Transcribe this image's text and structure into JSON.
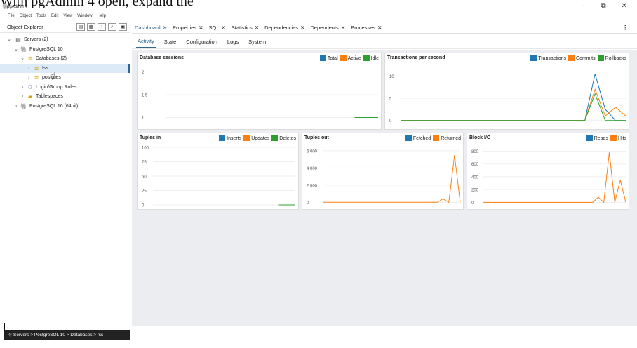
{
  "window": {
    "title": "pgAdmin 4",
    "overlay_text": "With pgAdmin 4 open, expand the",
    "controls": {
      "minimize": "–",
      "restore": "⧉",
      "close": "✕"
    }
  },
  "menu": [
    "File",
    "Object",
    "Tools",
    "Edit",
    "View",
    "Window",
    "Help"
  ],
  "explorer": {
    "title": "Object Explorer",
    "tree": [
      {
        "label": "Servers (2)"
      },
      {
        "label": "PostgreSQL 10"
      },
      {
        "label": "Databases (2)"
      },
      {
        "label": "fss"
      },
      {
        "label": "postgres"
      },
      {
        "label": "Login/Group Roles"
      },
      {
        "label": "Tablespaces"
      },
      {
        "label": "PostgreSQL 16 (64bit)"
      }
    ]
  },
  "tabs": [
    "Dashboard",
    "Properties",
    "SQL",
    "Statistics",
    "Dependencies",
    "Dependents",
    "Processes"
  ],
  "subtabs": [
    "Activity",
    "State",
    "Configuration",
    "Logs",
    "System"
  ],
  "colors": {
    "blue": "#1f77b4",
    "orange": "#ff7f0e",
    "green": "#2ca02c",
    "accent": "#326690"
  },
  "panels": {
    "sessions": {
      "title": "Database sessions",
      "legend": [
        "Total",
        "Active",
        "Idle"
      ]
    },
    "tps": {
      "title": "Transactions per second",
      "legend": [
        "Transactions",
        "Commits",
        "Rollbacks"
      ]
    },
    "tuples_in": {
      "title": "Tuples in",
      "legend": [
        "Inserts",
        "Updates",
        "Deletes"
      ]
    },
    "tuples_out": {
      "title": "Tuples out",
      "legend": [
        "Fetched",
        "Returned"
      ]
    },
    "block_io": {
      "title": "Block I/O",
      "legend": [
        "Reads",
        "Hits"
      ]
    }
  },
  "chart_data": [
    {
      "type": "line",
      "title": "Database sessions",
      "yticks": [
        "2",
        "1,5",
        "1"
      ],
      "ylim": [
        0.9,
        2.1
      ],
      "series": [
        {
          "name": "Total",
          "values": [
            2,
            2
          ]
        },
        {
          "name": "Idle",
          "values": [
            1,
            1
          ]
        }
      ]
    },
    {
      "type": "line",
      "title": "Transactions per second",
      "yticks": [
        "10",
        "5",
        "0"
      ],
      "ylim": [
        -1,
        12
      ],
      "series": [
        {
          "name": "Transactions",
          "values": [
            0,
            0,
            0,
            0,
            0,
            0,
            0,
            0,
            0,
            0,
            0,
            0,
            0,
            0,
            0,
            0,
            0,
            0,
            0,
            10.5,
            2.5,
            0,
            0
          ]
        },
        {
          "name": "Commits",
          "values": [
            0,
            0,
            0,
            0,
            0,
            0,
            0,
            0,
            0,
            0,
            0,
            0,
            0,
            0,
            0,
            0,
            0,
            0,
            0,
            7,
            1,
            3,
            1
          ]
        },
        {
          "name": "Rollbacks",
          "values": [
            0,
            0,
            0,
            0,
            0,
            0,
            0,
            0,
            0,
            0,
            0,
            0,
            0,
            0,
            0,
            0,
            0,
            0,
            0,
            6,
            0,
            0,
            0
          ]
        }
      ]
    },
    {
      "type": "line",
      "title": "Tuples in",
      "yticks": [
        "100",
        "75",
        "50",
        "25",
        "0"
      ],
      "ylim": [
        0,
        100
      ],
      "series": [
        {
          "name": "Deletes",
          "values": [
            0,
            0
          ]
        }
      ]
    },
    {
      "type": "line",
      "title": "Tuples out",
      "yticks": [
        "6 000",
        "4 000",
        "2 000",
        "0"
      ],
      "ylim": [
        -300,
        6400
      ],
      "series": [
        {
          "name": "Returned",
          "values": [
            0,
            0,
            0,
            0,
            0,
            0,
            0,
            0,
            0,
            0,
            0,
            0,
            0,
            0,
            0,
            0,
            0,
            0,
            0,
            0,
            0,
            400,
            0,
            5500,
            0
          ]
        }
      ]
    },
    {
      "type": "line",
      "title": "Block I/O",
      "yticks": [
        "800",
        "600",
        "400",
        "200",
        "0"
      ],
      "ylim": [
        -40,
        860
      ],
      "series": [
        {
          "name": "Hits",
          "values": [
            0,
            0,
            0,
            0,
            0,
            0,
            0,
            0,
            0,
            0,
            0,
            0,
            0,
            0,
            0,
            0,
            0,
            0,
            0,
            0,
            0,
            80,
            0,
            780,
            0,
            350,
            0
          ]
        }
      ]
    }
  ],
  "statusbar": {
    "breadcrumb": "Servers > PostgreSQL 10 > Databases > fss"
  }
}
